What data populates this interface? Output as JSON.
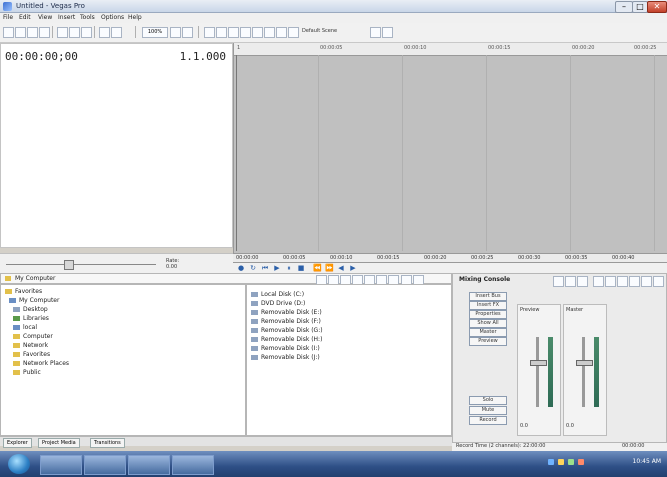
{
  "window": {
    "title": "Untitled - Vegas Pro",
    "buttons": {
      "minimize": "–",
      "maximize": "□",
      "close": "✕"
    }
  },
  "menu": [
    "File",
    "Edit",
    "View",
    "Insert",
    "Tools",
    "Options",
    "Help"
  ],
  "toolbar": {
    "zoom_label": "100%",
    "new_save_label": "Default Scene"
  },
  "timecode": {
    "time": "00:00:00;00",
    "beats": "1.1.000"
  },
  "ruler": {
    "marks": [
      "1",
      "00:00:05",
      "00:00:10",
      "00:00:15",
      "00:00:20",
      "00:00:25"
    ]
  },
  "timeline": {
    "marks": [
      "00:00:00",
      "00:00:05",
      "00:00:10",
      "00:00:15",
      "00:00:20",
      "00:00:25",
      "00:00:30",
      "00:00:35",
      "00:00:40"
    ]
  },
  "rate": {
    "label": "Rate:",
    "value": "0.00"
  },
  "explorer": {
    "path": "My Computer",
    "tree": [
      "Favorites",
      "My Computer",
      "Desktop",
      "Libraries",
      "local",
      "Computer",
      "Network",
      "Favorites",
      "Network Places",
      "Public"
    ],
    "files": [
      "Local Disk (C:)",
      "DVD Drive (D:)",
      "Removable Disk (E:)",
      "Removable Disk (F:)",
      "Removable Disk (G:)",
      "Removable Disk (H:)",
      "Removable Disk (I:)",
      "Removable Disk (J:)"
    ]
  },
  "mixer": {
    "title": "Mixing Console",
    "buttons": [
      "Insert Bus",
      "Insert FX",
      "Properties",
      "Show All",
      "Master",
      "Preview",
      "Solo",
      "Mute",
      "Record"
    ],
    "channels": [
      {
        "name": "Preview",
        "value": "0.0"
      },
      {
        "name": "Master",
        "value": "0.0"
      }
    ]
  },
  "tabs": [
    "Explorer",
    "Project Media",
    "Transitions"
  ],
  "status": {
    "left": "Record Time (2 channels): 22:00:00",
    "right": "00:00:00"
  },
  "taskbar": {
    "clock": "10:45 AM"
  },
  "colors": {
    "accent": "#2b5fa8",
    "track_bg": "#c0c0c0",
    "meter": "#2e6b55"
  }
}
